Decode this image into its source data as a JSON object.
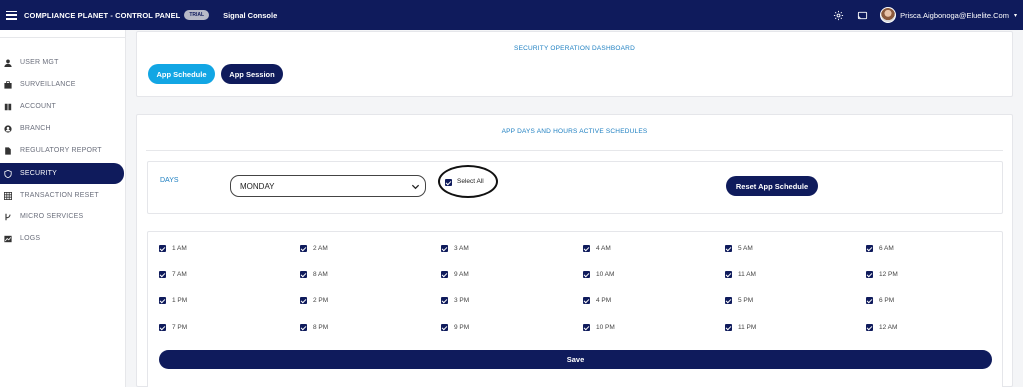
{
  "header": {
    "title": "COMPLIANCE PLANET - CONTROL PANEL",
    "badge": "TRIAL",
    "console": "Signal Console",
    "user_email": "Prisca.Aigbonoga@Eluelite.Com",
    "icons": [
      "menu-icon",
      "gear-icon",
      "cast-icon",
      "avatar",
      "chevron-down-icon"
    ]
  },
  "sidebar": {
    "items": [
      {
        "label": "USER MGT",
        "icon": "user-icon"
      },
      {
        "label": "SURVEILLANCE",
        "icon": "briefcase-icon"
      },
      {
        "label": "ACCOUNT",
        "icon": "book-icon"
      },
      {
        "label": "BRANCH",
        "icon": "user-circle-icon"
      },
      {
        "label": "REGULATORY REPORT",
        "icon": "file-icon"
      },
      {
        "label": "SECURITY",
        "icon": "shield-icon",
        "active": true
      },
      {
        "label": "TRANSACTION RESET",
        "icon": "grid-icon"
      },
      {
        "label": "MICRO SERVICES",
        "icon": "branch-icon"
      },
      {
        "label": "LOGS",
        "icon": "chart-icon"
      }
    ]
  },
  "dashboard": {
    "title": "SECURITY OPERATION DASHBOARD",
    "buttons": {
      "schedule": "App Schedule",
      "session": "App Session"
    }
  },
  "schedules": {
    "title": "APP DAYS AND HOURS ACTIVE SCHEDULES",
    "days_label": "DAYS",
    "selected_day": "MONDAY",
    "select_all_label": "Select All",
    "select_all_checked": true,
    "reset_label": "Reset App Schedule",
    "hours": [
      "1 AM",
      "2 AM",
      "3 AM",
      "4 AM",
      "5 AM",
      "6 AM",
      "7 AM",
      "8 AM",
      "9 AM",
      "10 AM",
      "11 AM",
      "12 PM",
      "1 PM",
      "2 PM",
      "3 PM",
      "4 PM",
      "5 PM",
      "6 PM",
      "7 PM",
      "8 PM",
      "9 PM",
      "10 PM",
      "11 PM",
      "12 AM"
    ],
    "save_label": "Save"
  },
  "colors": {
    "navy": "#0f1b5c",
    "accent_blue": "#12a6e4",
    "title_blue": "#1d7fc1"
  }
}
